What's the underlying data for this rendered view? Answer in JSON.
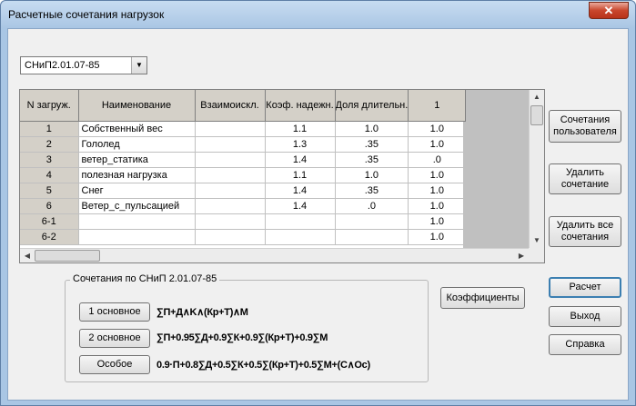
{
  "window": {
    "title": "Расчетные сочетания нагрузок",
    "close_glyph": "✕"
  },
  "norm_select": {
    "value": "СНиП2.01.07-85",
    "arrow": "▼"
  },
  "grid": {
    "columns": [
      "N загруж.",
      "Наименование",
      "Взаимоискл.",
      "Коэф. надежн.",
      "Доля длительн.",
      "1"
    ],
    "rows": [
      {
        "n": "1",
        "name": "Собственный вес",
        "excl": "",
        "coef": "1.1",
        "share": "1.0",
        "c1": "1.0"
      },
      {
        "n": "2",
        "name": "Гололед",
        "excl": "",
        "coef": "1.3",
        "share": ".35",
        "c1": "1.0"
      },
      {
        "n": "3",
        "name": "ветер_статика",
        "excl": "",
        "coef": "1.4",
        "share": ".35",
        "c1": ".0"
      },
      {
        "n": "4",
        "name": "полезная нагрузка",
        "excl": "",
        "coef": "1.1",
        "share": "1.0",
        "c1": "1.0"
      },
      {
        "n": "5",
        "name": "Снег",
        "excl": "",
        "coef": "1.4",
        "share": ".35",
        "c1": "1.0"
      },
      {
        "n": "6",
        "name": "Ветер_с_пульсацией",
        "excl": "",
        "coef": "1.4",
        "share": ".0",
        "c1": "1.0"
      },
      {
        "n": "6-1",
        "name": "",
        "excl": "",
        "coef": "",
        "share": "",
        "c1": "1.0"
      },
      {
        "n": "6-2",
        "name": "",
        "excl": "",
        "coef": "",
        "share": "",
        "c1": "1.0"
      }
    ],
    "scroll_up": "▲",
    "scroll_down": "▼",
    "scroll_left": "◀",
    "scroll_right": "▶"
  },
  "buttons": {
    "user_combos": "Сочетания пользователя",
    "delete_combo": "Удалить сочетание",
    "delete_all": "Удалить все сочетания",
    "coefficients": "Коэффициенты",
    "calculate": "Расчет",
    "exit": "Выход",
    "help": "Справка"
  },
  "snip_group": {
    "label": "Сочетания по СНиП 2.01.07-85",
    "items": [
      {
        "button": "1 основное",
        "formula": "∑П+Д∧K∧(Кр+Т)∧М"
      },
      {
        "button": "2 основное",
        "formula": "∑П+0.95∑Д+0.9∑К+0.9∑(Кр+Т)+0.9∑М"
      },
      {
        "button": "Особое",
        "formula": "0.9·П+0.8∑Д+0.5∑К+0.5∑(Кр+Т)+0.5∑М+(С∧Ос)"
      }
    ]
  }
}
